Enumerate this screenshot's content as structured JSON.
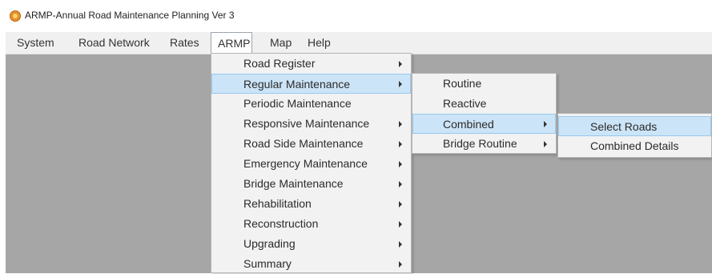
{
  "window": {
    "title": "ARMP-Annual Road Maintenance Planning Ver 3",
    "icon": "app-logo-icon"
  },
  "menubar": {
    "items": [
      {
        "label": "System"
      },
      {
        "label": "Road Network"
      },
      {
        "label": "Rates"
      },
      {
        "label": "ARMP",
        "active": true
      },
      {
        "label": "Map"
      },
      {
        "label": "Help"
      }
    ]
  },
  "armp_menu": {
    "items": [
      {
        "label": "Road Register",
        "submenu": true
      },
      {
        "label": "Regular Maintenance",
        "submenu": true,
        "highlighted": true
      },
      {
        "label": "Periodic Maintenance",
        "submenu": false
      },
      {
        "label": "Responsive Maintenance",
        "submenu": true
      },
      {
        "label": "Road Side Maintenance",
        "submenu": true
      },
      {
        "label": "Emergency Maintenance",
        "submenu": true
      },
      {
        "label": "Bridge Maintenance",
        "submenu": true
      },
      {
        "label": "Rehabilitation",
        "submenu": true
      },
      {
        "label": "Reconstruction",
        "submenu": true
      },
      {
        "label": "Upgrading",
        "submenu": true
      },
      {
        "label": "Summary",
        "submenu": true
      }
    ]
  },
  "regular_maintenance_menu": {
    "items": [
      {
        "label": "Routine",
        "submenu": false
      },
      {
        "label": "Reactive",
        "submenu": false
      },
      {
        "label": "Combined",
        "submenu": true,
        "highlighted": true
      },
      {
        "label": "Bridge Routine",
        "submenu": true
      }
    ]
  },
  "combined_menu": {
    "items": [
      {
        "label": "Select Roads",
        "highlighted": true
      },
      {
        "label": "Combined Details"
      }
    ]
  },
  "colors": {
    "workspace": "#a6a6a6",
    "menu_bg": "#f2f2f2",
    "highlight": "#cce4f7",
    "highlight_border": "#99c9ef",
    "app_icon": "#e8902a"
  }
}
